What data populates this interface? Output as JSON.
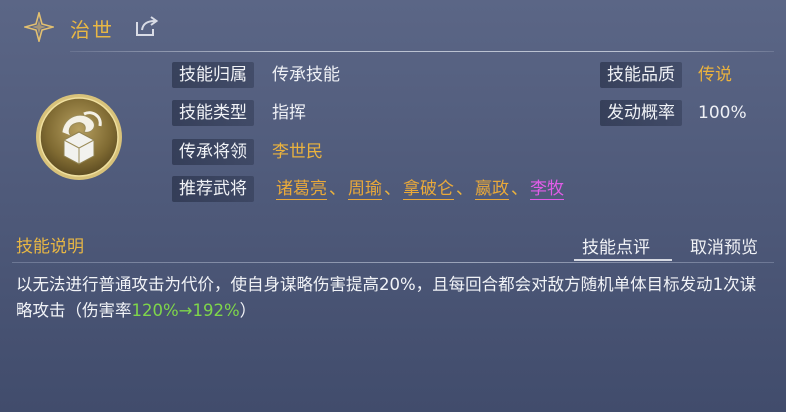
{
  "header": {
    "title": "治世"
  },
  "info": {
    "rows": [
      {
        "label": "技能归属",
        "value": "传承技能"
      },
      {
        "label": "技能类型",
        "value": "指挥"
      },
      {
        "label": "传承将领",
        "value": "李世民"
      },
      {
        "label": "推荐武将"
      }
    ],
    "quality": {
      "label": "技能品质",
      "value": "传说"
    },
    "trigger": {
      "label": "发动概率",
      "value": "100%"
    },
    "heroes": [
      "诸葛亮",
      "周瑜",
      "拿破仑",
      "嬴政",
      "李牧"
    ],
    "separator": "、"
  },
  "description": {
    "title": "技能说明",
    "tabs": {
      "review": "技能点评",
      "cancel_preview": "取消预览"
    },
    "text_before": "以无法进行普通攻击为代价，使自身谋略伤害提高20%，且每回合都会对敌方随机单体目标发动1次谋略攻击（伤害率",
    "rate": "120%→192%",
    "text_after": "）"
  },
  "colors": {
    "gold": "#eab23e",
    "pink": "#e15ce8",
    "green": "#7fd64a"
  },
  "icons": [
    "compass-star-icon",
    "share-icon",
    "skill-medal-icon"
  ]
}
